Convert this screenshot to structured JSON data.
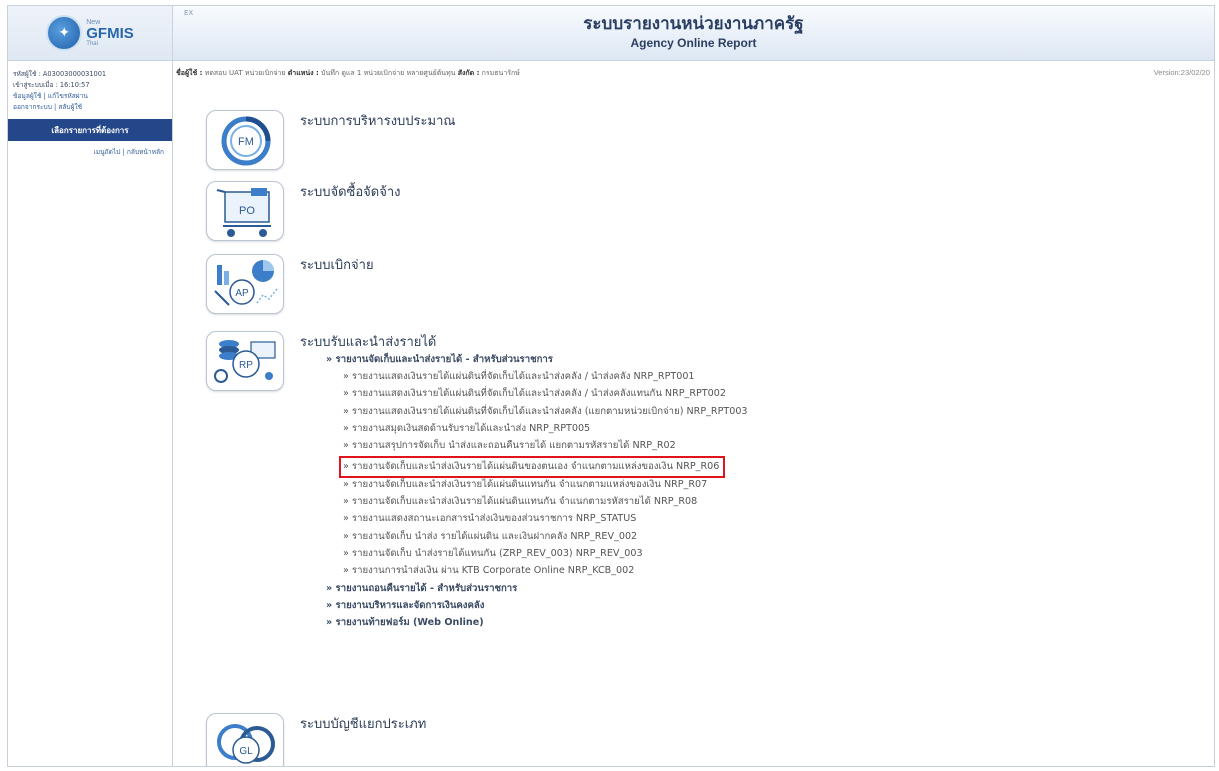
{
  "sidebar": {
    "logo": {
      "new": "New",
      "main": "GFMIS",
      "sub": "Thai"
    },
    "info_lines": [
      "รหัสผู้ใช้ : A03003000031001",
      "เข้าสู่ระบบเมื่อ : 16:10:57"
    ],
    "links": [
      "ข้อมูลผู้ใช้ | แก้ไขรหัสผ่าน",
      "ออกจากระบบ | สลับผู้ใช้"
    ],
    "menu_head": "เลือกรายการที่ต้องการ",
    "menu_sub": "เมนูถัดไป | กลับหน้าหลัก"
  },
  "header": {
    "corner": "EX",
    "title": "ระบบรายงานหน่วยงานภาครัฐ",
    "subtitle": "Agency Online Report"
  },
  "userline": {
    "label_user": "ชื่อผู้ใช้ :",
    "user": "ทดสอบ UAT หน่วยเบิกจ่าย",
    "label_pos": "ตำแหน่ง :",
    "pos": "บันทึก ดูแล 1 หน่วยเบิกจ่าย หลายศูนย์ต้นทุน",
    "label_org": "สังกัด :",
    "org": "กรมธนารักษ์"
  },
  "version": "Version:23/02/20",
  "modules": [
    {
      "icon": "FM",
      "title": "ระบบการบริหารงบประมาณ"
    },
    {
      "icon": "PO",
      "title": "ระบบจัดซื้อจัดจ้าง"
    },
    {
      "icon": "AP",
      "title": "ระบบเบิกจ่าย"
    },
    {
      "icon": "RP",
      "title": "ระบบรับและนำส่งรายได้"
    },
    {
      "icon": "GL",
      "title": "ระบบบัญชีแยกประเภท"
    }
  ],
  "revenue": {
    "section1": "» รายงานจัดเก็บและนำส่งรายได้ - สำหรับส่วนราชการ",
    "items": [
      "» รายงานแสดงเงินรายได้แผ่นดินที่จัดเก็บได้และนำส่งคลัง / นำส่งคลัง NRP_RPT001",
      "» รายงานแสดงเงินรายได้แผ่นดินที่จัดเก็บได้และนำส่งคลัง / นำส่งคลังแทนกัน NRP_RPT002",
      "» รายงานแสดงเงินรายได้แผ่นดินที่จัดเก็บได้และนำส่งคลัง (แยกตามหน่วยเบิกจ่าย) NRP_RPT003",
      "» รายงานสมุดเงินสดด้านรับรายได้และนำส่ง NRP_RPT005",
      "» รายงานสรุปการจัดเก็บ นำส่งและถอนคืนรายได้ แยกตามรหัสรายได้ NRP_R02",
      "» รายงานจัดเก็บและนำส่งเงินรายได้แผ่นดินของตนเอง จำแนกตามแหล่งของเงิน NRP_R06",
      "» รายงานจัดเก็บและนำส่งเงินรายได้แผ่นดินแทนกัน จำแนกตามแหล่งของเงิน NRP_R07",
      "» รายงานจัดเก็บและนำส่งเงินรายได้แผ่นดินแทนกัน จำแนกตามรหัสรายได้ NRP_R08",
      "» รายงานแสดงสถานะเอกสารนำส่งเงินของส่วนราชการ NRP_STATUS",
      "» รายงานจัดเก็บ นำส่ง รายได้แผ่นดิน และเงินฝากคลัง NRP_REV_002",
      "» รายงานจัดเก็บ นำส่งรายได้แทนกัน (ZRP_REV_003) NRP_REV_003",
      "» รายงานการนำส่งเงิน ผ่าน KTB Corporate Online NRP_KCB_002"
    ],
    "section2": "» รายงานถอนคืนรายได้ - สำหรับส่วนราชการ",
    "section3": "» รายงานบริหารและจัดการเงินคงคลัง",
    "section4": "» รายงานท้ายฟอร์ม (Web Online)"
  },
  "colors": {
    "highlight": "#e0151b",
    "sidebar_head": "#24478a"
  }
}
